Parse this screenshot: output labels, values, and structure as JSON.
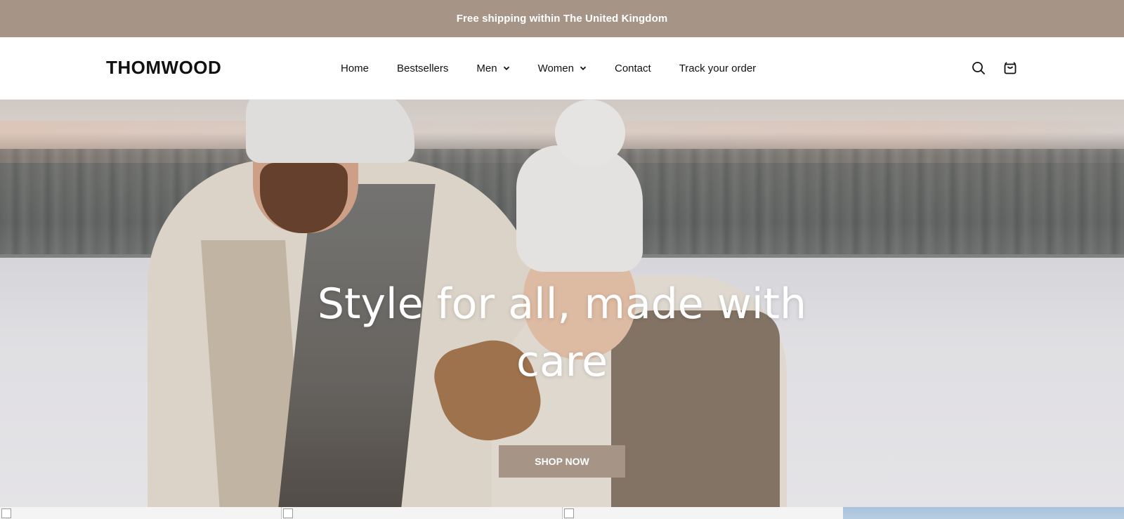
{
  "announcement": {
    "text": "Free shipping within The United Kingdom"
  },
  "header": {
    "logo": "THOMWOOD",
    "nav": [
      {
        "label": "Home",
        "dropdown": false
      },
      {
        "label": "Bestsellers",
        "dropdown": false
      },
      {
        "label": "Men",
        "dropdown": true
      },
      {
        "label": "Women",
        "dropdown": true
      },
      {
        "label": "Contact",
        "dropdown": false
      },
      {
        "label": "Track your order",
        "dropdown": false
      }
    ],
    "icons": [
      "search-icon",
      "cart-icon"
    ]
  },
  "hero": {
    "title_line1": "Style for all, made with",
    "title_line2": "care",
    "button_label": "SHOP NOW"
  },
  "colors": {
    "accent": "#a69587",
    "text": "#111111",
    "background": "#ffffff"
  }
}
